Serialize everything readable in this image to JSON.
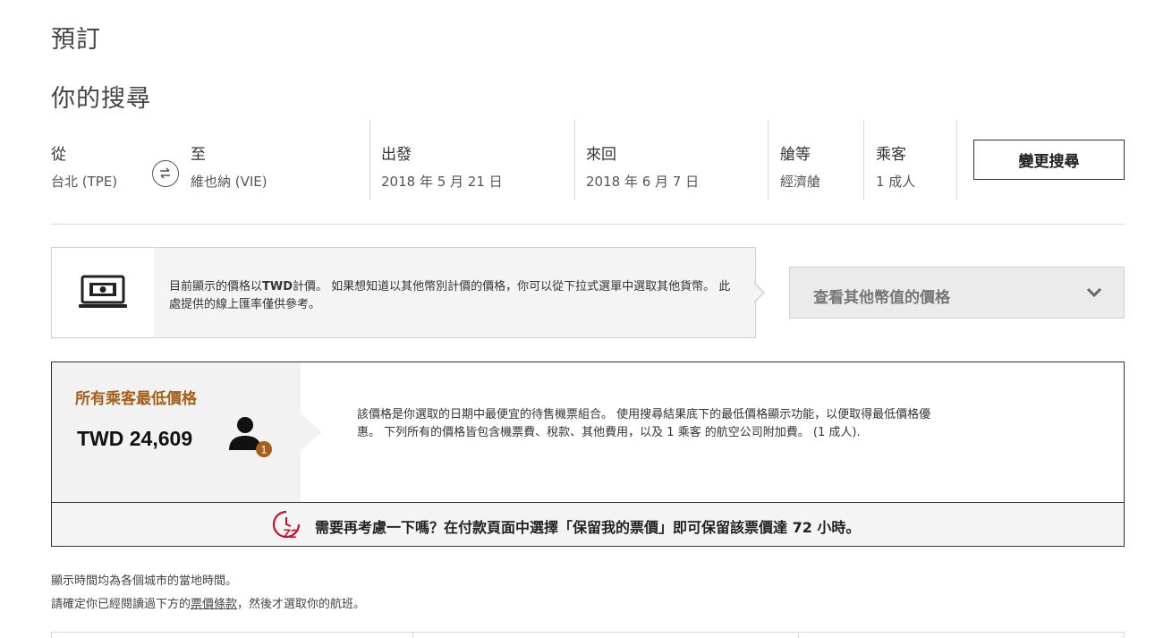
{
  "page": {
    "title": "預訂",
    "search_title": "你的搜尋"
  },
  "search": {
    "from_label": "從",
    "from_value": "台北 (TPE)",
    "to_label": "至",
    "to_value": "維也納 (VIE)",
    "depart_label": "出發",
    "depart_value": "2018 年 5 月 21 日",
    "return_label": "來回",
    "return_value": "2018 年 6 月 7 日",
    "cabin_label": "艙等",
    "cabin_value": "經濟艙",
    "pax_label": "乘客",
    "pax_value": "1 成人",
    "change_button": "變更搜尋"
  },
  "currency": {
    "text_prefix": "目前顯示的價格以",
    "currency_code": "TWD",
    "text_suffix": "計價。 如果想知道以其他幣別計價的價格，你可以從下拉式選單中選取其他貨幣。 此處提供的線上匯率僅供參考。",
    "select_label": "查看其他幣值的價格",
    "icon": "money-laptop-icon"
  },
  "lowest_price": {
    "label": "所有乘客最低價格",
    "amount": "TWD 24,609",
    "passenger_count": "1",
    "description": "該價格是你選取的日期中最便宜的待售機票組合。 使用搜尋結果底下的最低價格顯示功能，以便取得最低價格優惠。 下列所有的價格皆包含機票費、稅款、其他費用，以及 1 乘客 的航空公司附加費。 (1 成人).",
    "hold_icon_text": "72",
    "hold_text": "需要再考慮一下嗎？在付款頁面中選擇「保留我的票價」即可保留該票價達 72 小時。"
  },
  "notes": {
    "local_time": "顯示時間均為各個城市的當地時間。",
    "confirm_prefix": "請確定你已經閱讀過下方的",
    "confirm_link": "票價條款",
    "confirm_suffix": "，然後才選取你的航班。"
  },
  "colors": {
    "accent": "#a4601a",
    "hold_red": "#c8102e",
    "badge": "#a4601a"
  }
}
